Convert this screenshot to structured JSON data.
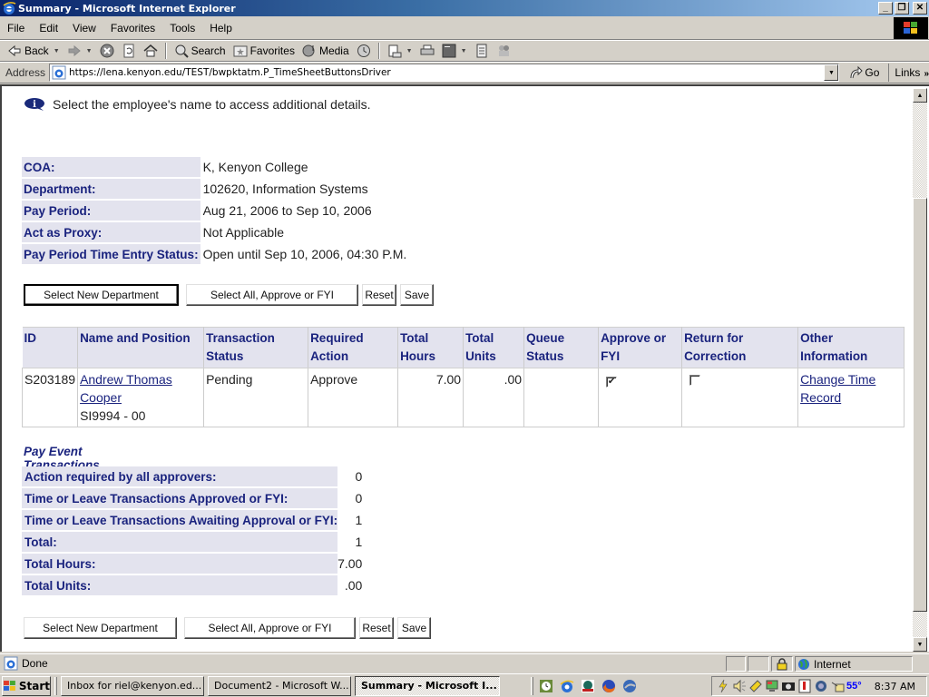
{
  "window": {
    "title": "Summary - Microsoft Internet Explorer",
    "minimize": "_",
    "restore": "❐",
    "close": "✕"
  },
  "menu": [
    "File",
    "Edit",
    "View",
    "Favorites",
    "Tools",
    "Help"
  ],
  "toolbar": {
    "back": "Back",
    "search": "Search",
    "favorites": "Favorites",
    "media": "Media"
  },
  "address": {
    "label": "Address",
    "url": "https://lena.kenyon.edu/TEST/bwpktatm.P_TimeSheetButtonsDriver",
    "go": "Go",
    "links": "Links"
  },
  "page": {
    "info_text": "Select the employee's name to access additional details.",
    "details": [
      {
        "label": "COA:",
        "value": "K, Kenyon College"
      },
      {
        "label": "Department:",
        "value": "102620, Information Systems"
      },
      {
        "label": "Pay Period:",
        "value": "Aug 21, 2006 to Sep 10, 2006"
      },
      {
        "label": "Act as Proxy:",
        "value": "Not Applicable"
      },
      {
        "label": "Pay Period Time Entry Status:",
        "value": "Open until Sep 10, 2006, 04:30 P.M."
      }
    ],
    "buttons": {
      "select_dept": "Select New Department",
      "select_all": "Select All, Approve or FYI",
      "reset": "Reset",
      "save": "Save"
    },
    "table": {
      "headers": [
        "ID",
        "Name and Position",
        "Transaction Status",
        "Required Action",
        "Total Hours",
        "Total Units",
        "Queue Status",
        "Approve or FYI",
        "Return for Correction",
        "Other Information"
      ],
      "rows": [
        {
          "id": "S203189",
          "name": "Andrew Thomas Cooper",
          "position": "SI9994 - 00",
          "transaction_status": "Pending",
          "required_action": "Approve",
          "total_hours": "7.00",
          "total_units": ".00",
          "queue_status": "",
          "approve_checked": true,
          "return_checked": false,
          "other_info_link": "Change Time Record"
        }
      ]
    },
    "pay_event": {
      "title": "Pay Event Transactions",
      "items": [
        {
          "label": "Action required by all approvers:",
          "value": "0"
        },
        {
          "label": "Time or Leave Transactions Approved or FYI:",
          "value": "0"
        },
        {
          "label": "Time or Leave Transactions Awaiting Approval or FYI:",
          "value": "1"
        },
        {
          "label": "Total:",
          "value": "1"
        },
        {
          "label": "Total Hours:",
          "value": "7.00"
        },
        {
          "label": "Total Units:",
          "value": ".00"
        }
      ]
    }
  },
  "status": {
    "text": "Done",
    "zone": "Internet"
  },
  "taskbar": {
    "start": "Start",
    "tasks": [
      {
        "label": "Inbox for riel@kenyon.ed...",
        "icon": "thunderbird-icon",
        "active": false
      },
      {
        "label": "Document2 - Microsoft W...",
        "icon": "word-icon",
        "active": false
      },
      {
        "label": "Summary - Microsoft I...",
        "icon": "ie-icon",
        "active": true
      }
    ],
    "temperature": "55°",
    "clock": "8:37 AM"
  },
  "colors": {
    "label_bg": "#e3e3ee",
    "label_text": "#1a237e",
    "link": "#1a237e"
  }
}
